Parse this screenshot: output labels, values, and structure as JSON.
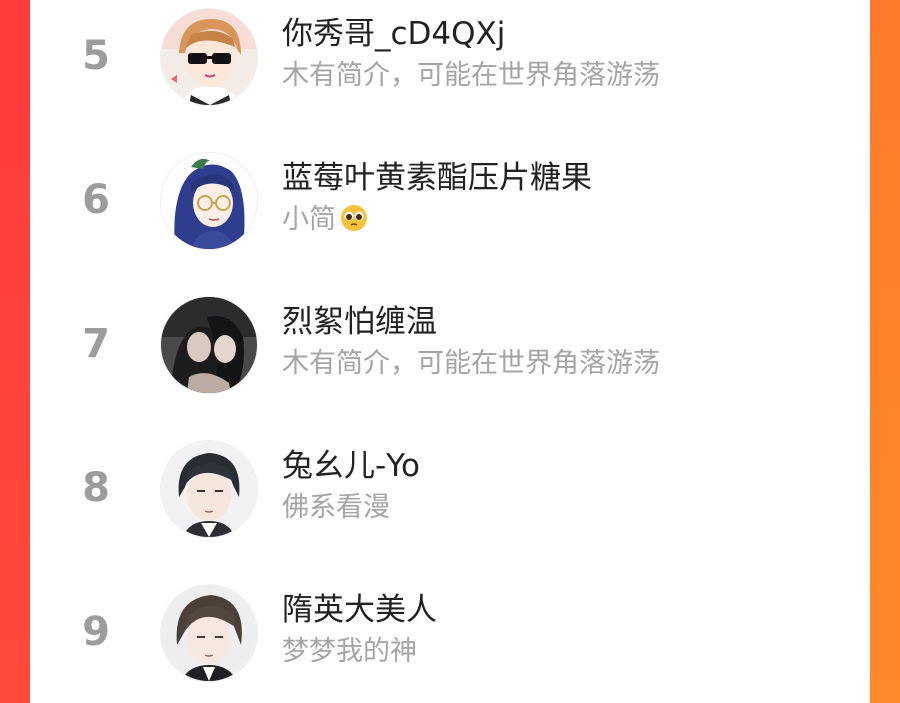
{
  "accent": {
    "left_border": "#ff3d3a",
    "right_border": "#ff7a2c",
    "panel": "#ffffff",
    "rank_color": "#9c9c9c",
    "bio_color": "#a5a5a5"
  },
  "users": [
    {
      "rank": "5",
      "name": "你秀哥_cD4QXj",
      "bio": "木有简介，可能在世界角落游荡",
      "avatar": "anime-boy-sunglasses-avatar"
    },
    {
      "rank": "6",
      "name": "蓝莓叶黄素酯压片糖果",
      "bio": "小简",
      "bio_emoji": "pleading-face-emoji",
      "avatar": "anime-blue-hair-glasses-avatar"
    },
    {
      "rank": "7",
      "name": "烈絮怕缠温",
      "bio": "木有简介，可能在世界角落游荡",
      "avatar": "dark-couple-illustration-avatar"
    },
    {
      "rank": "8",
      "name": "兔幺儿-Yo",
      "bio": "佛系看漫",
      "avatar": "anime-dark-hair-man-avatar"
    },
    {
      "rank": "9",
      "name": "隋英大美人",
      "bio": "梦梦我的神",
      "avatar": "anime-man-portrait-avatar"
    }
  ]
}
